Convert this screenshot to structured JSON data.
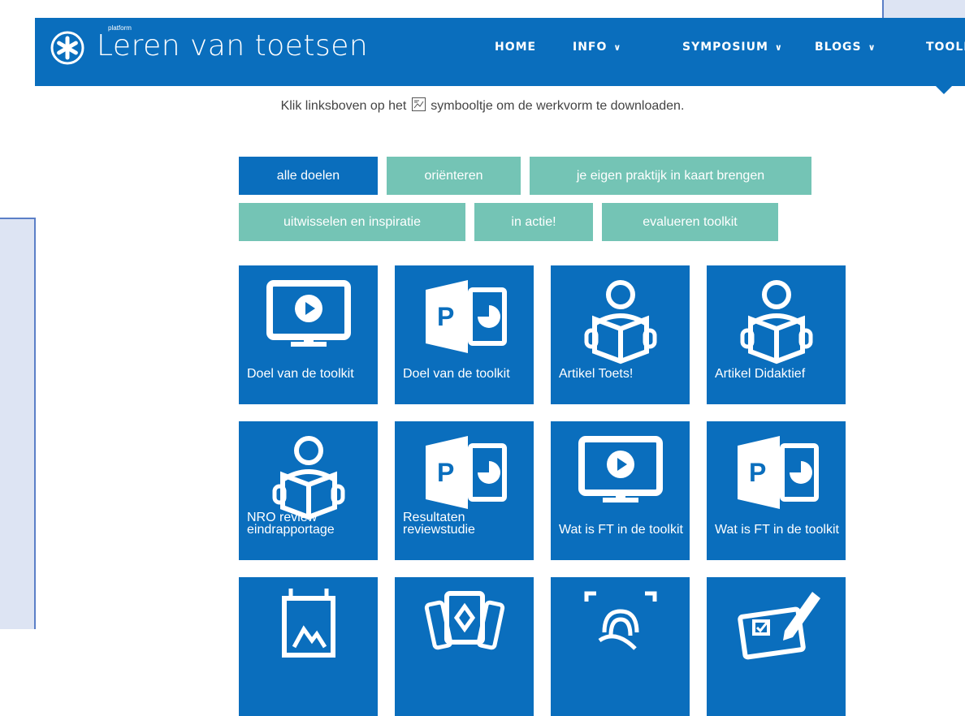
{
  "brand": {
    "small": "platform",
    "name": "Leren van toetsen"
  },
  "nav": [
    {
      "label": "HOME",
      "chevron": false
    },
    {
      "label": "INFO",
      "chevron": true
    },
    {
      "label": "SYMPOSIUM",
      "chevron": true
    },
    {
      "label": "BLOGS",
      "chevron": true
    },
    {
      "label": "TOOLKIT",
      "chevron": false
    }
  ],
  "chevron_glyph": "∨",
  "intro": {
    "before": "Klik linksboven op het",
    "after": "symbooltje om de werkvorm te downloaden."
  },
  "filters": [
    {
      "label": "alle doelen",
      "active": true
    },
    {
      "label": "oriënteren",
      "active": false
    },
    {
      "label": "je eigen praktijk in kaart brengen",
      "active": false
    },
    {
      "label": "uitwisselen en inspiratie",
      "active": false
    },
    {
      "label": "in actie!",
      "active": false
    },
    {
      "label": "evalueren toolkit",
      "active": false
    }
  ],
  "tiles": [
    {
      "label": "Doel van de toolkit",
      "icon": "monitor-play-icon"
    },
    {
      "label": "Doel van de toolkit",
      "icon": "powerpoint-icon"
    },
    {
      "label": "Artikel Toets!",
      "icon": "reader-book-icon"
    },
    {
      "label": "Artikel Didaktief",
      "icon": "reader-book-icon"
    },
    {
      "label": "NRO review eindrapportage",
      "icon": "reader-book-icon"
    },
    {
      "label": "Resultaten reviewstudie",
      "icon": "powerpoint-icon"
    },
    {
      "label": "Wat is FT in de toolkit",
      "icon": "monitor-play-icon"
    },
    {
      "label": "Wat is FT in de toolkit",
      "icon": "powerpoint-icon"
    },
    {
      "label": "",
      "icon": "hanging-poster-icon"
    },
    {
      "label": "",
      "icon": "playing-cards-icon"
    },
    {
      "label": "",
      "icon": "fingerprint-scan-icon"
    },
    {
      "label": "",
      "icon": "write-form-icon"
    }
  ],
  "colors": {
    "primary": "#0a6ebd",
    "filter": "#74c4b5",
    "sidebar": "#dde4f3"
  }
}
